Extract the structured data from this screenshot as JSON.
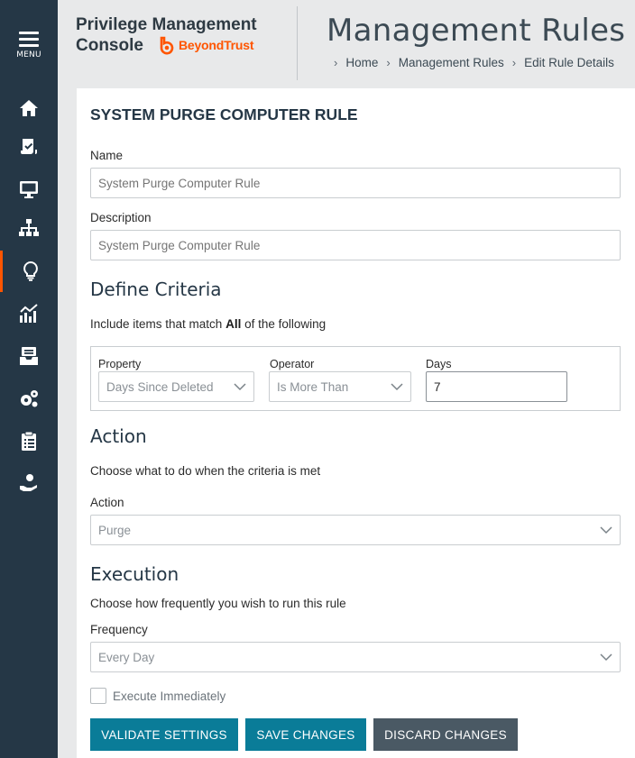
{
  "sidebar": {
    "menu_label": "MENU",
    "items": [
      {
        "icon": "home-icon"
      },
      {
        "icon": "policy-checklist-icon"
      },
      {
        "icon": "computer-icon"
      },
      {
        "icon": "groups-hierarchy-icon"
      },
      {
        "icon": "lightbulb-icon",
        "active": true
      },
      {
        "icon": "analytics-icon"
      },
      {
        "icon": "inbox-tray-icon"
      },
      {
        "icon": "gears-icon"
      },
      {
        "icon": "clipboard-icon"
      },
      {
        "icon": "user-hand-icon"
      }
    ],
    "accent_color": "#ff5500"
  },
  "header": {
    "brand_line1": "Privilege Management",
    "brand_line2": "Console",
    "logo_text": "BeyondTrust",
    "page_title": "Management Rules",
    "breadcrumb": [
      "Home",
      "Management Rules",
      "Edit Rule Details"
    ]
  },
  "form": {
    "rule_title": "SYSTEM PURGE COMPUTER RULE",
    "name_label": "Name",
    "name_placeholder": "System Purge Computer Rule",
    "description_label": "Description",
    "description_placeholder": "System Purge Computer Rule",
    "criteria": {
      "section_title": "Define Criteria",
      "intro_prefix": "Include items that match ",
      "intro_bold": "All",
      "intro_suffix": " of the following",
      "property_label": "Property",
      "property_value": "Days Since Deleted",
      "operator_label": "Operator",
      "operator_value": "Is More Than",
      "days_label": "Days",
      "days_value": "7"
    },
    "action": {
      "section_title": "Action",
      "intro": "Choose what to do when the criteria is met",
      "label": "Action",
      "value": "Purge"
    },
    "execution": {
      "section_title": "Execution",
      "intro": "Choose how frequently you wish to run this rule",
      "frequency_label": "Frequency",
      "frequency_value": "Every Day",
      "execute_immediately_label": "Execute Immediately"
    },
    "buttons": {
      "validate": "VALIDATE SETTINGS",
      "save": "SAVE CHANGES",
      "discard": "DISCARD CHANGES"
    }
  }
}
